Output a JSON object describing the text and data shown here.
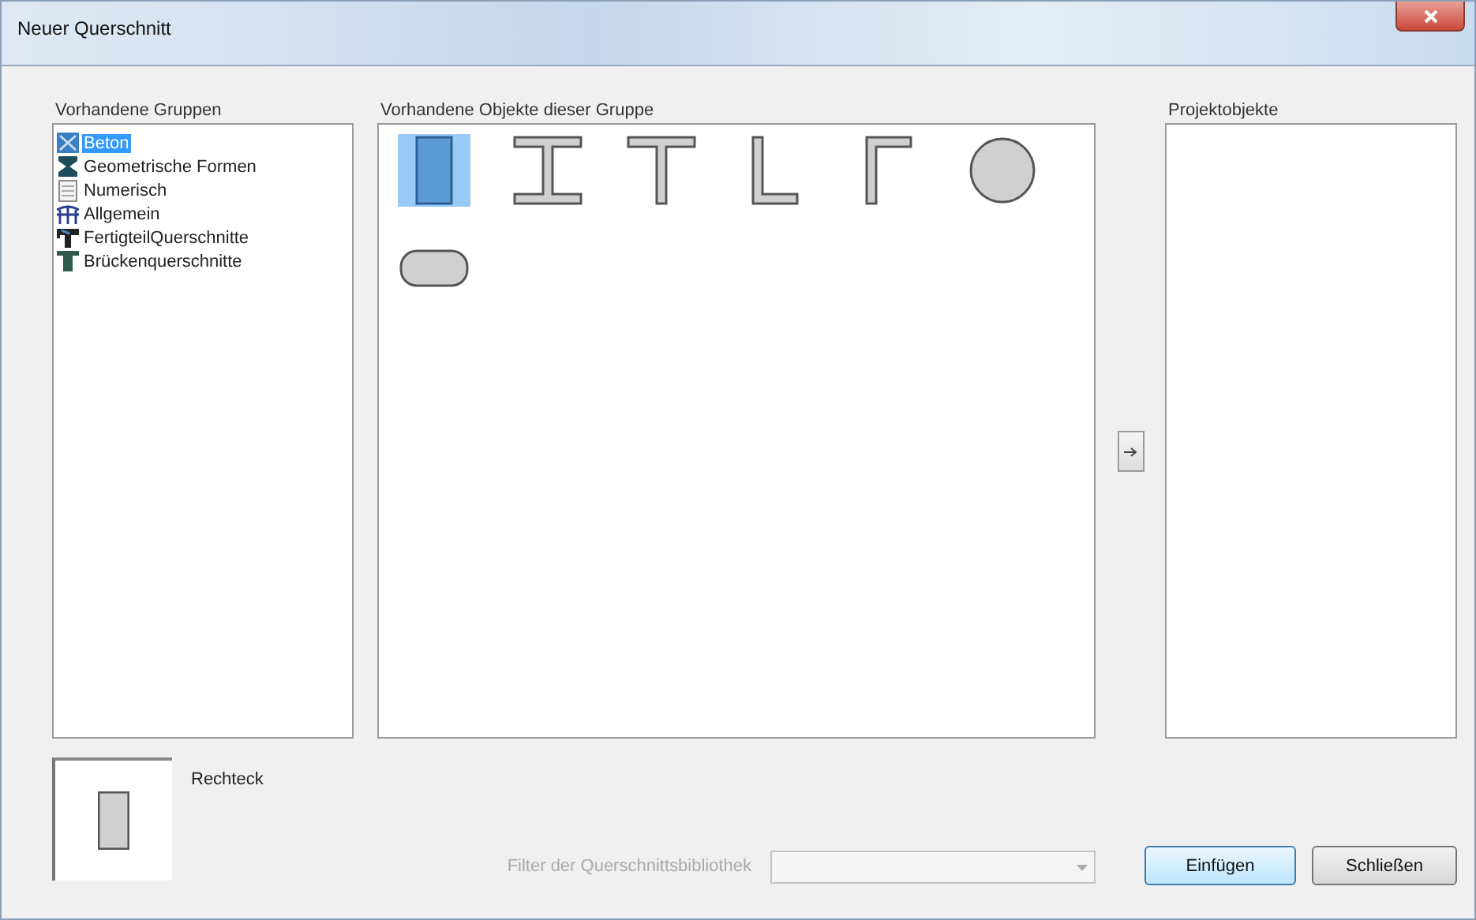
{
  "window": {
    "title": "Neuer Querschnitt"
  },
  "groups": {
    "heading": "Vorhandene Gruppen",
    "items": [
      {
        "label": "Beton",
        "kind": "concrete",
        "selected": true
      },
      {
        "label": "Geometrische Formen",
        "kind": "geometry",
        "selected": false
      },
      {
        "label": "Numerisch",
        "kind": "numeric",
        "selected": false
      },
      {
        "label": "Allgemein",
        "kind": "general",
        "selected": false
      },
      {
        "label": "FertigteilQuerschnitte",
        "kind": "precast",
        "selected": false
      },
      {
        "label": "Brückenquerschnitte",
        "kind": "bridge",
        "selected": false
      }
    ]
  },
  "objects": {
    "heading": "Vorhandene Objekte dieser Gruppe",
    "items": [
      {
        "kind": "rect",
        "selected": true
      },
      {
        "kind": "i-beam",
        "selected": false
      },
      {
        "kind": "t-beam",
        "selected": false
      },
      {
        "kind": "l-angle",
        "selected": false
      },
      {
        "kind": "gamma",
        "selected": false
      },
      {
        "kind": "circle",
        "selected": false
      },
      {
        "kind": "rounded",
        "selected": false
      }
    ]
  },
  "project": {
    "heading": "Projektobjekte"
  },
  "preview": {
    "kind": "rect",
    "label": "Rechteck"
  },
  "filter": {
    "label": "Filter der Querschnittsbibliothek",
    "disabled": true
  },
  "buttons": [
    {
      "label": "Einfügen",
      "default": true
    },
    {
      "label": "Schließen",
      "default": false
    }
  ]
}
